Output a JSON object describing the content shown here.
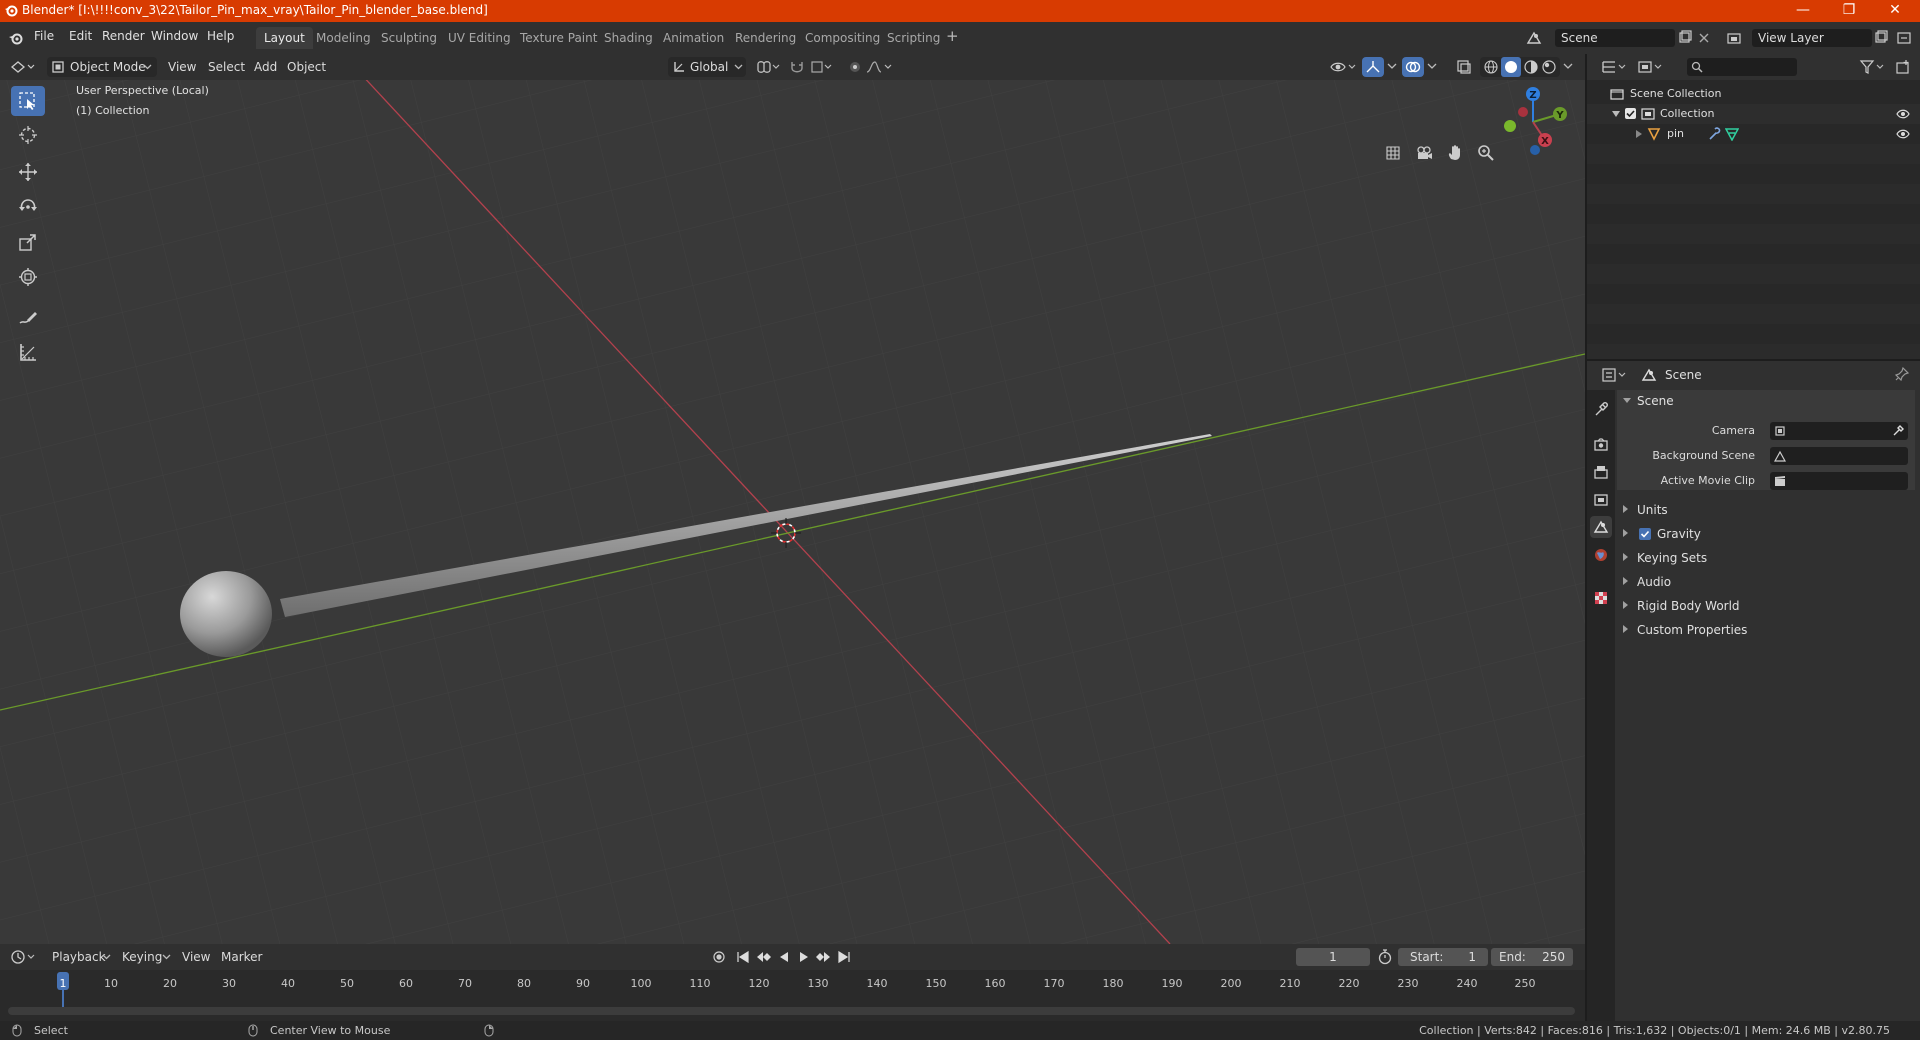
{
  "window": {
    "title": "Blender* [I:\\!!!!conv_3\\22\\Tailor_Pin_max_vray\\Tailor_Pin_blender_base.blend]",
    "minimize": "—",
    "maximize": "❐",
    "close": "✕"
  },
  "menus": [
    "File",
    "Edit",
    "Render",
    "Window",
    "Help"
  ],
  "workspaces": {
    "active": "Layout",
    "tabs": [
      "Layout",
      "Modeling",
      "Sculpting",
      "UV Editing",
      "Texture Paint",
      "Shading",
      "Animation",
      "Rendering",
      "Compositing",
      "Scripting"
    ],
    "add": "+"
  },
  "scene_field": "Scene",
  "view_layer_field": "View Layer",
  "viewport_header": {
    "mode": "Object Mode",
    "view": "View",
    "select": "Select",
    "add": "Add",
    "object": "Object",
    "transform_orientation": "Global"
  },
  "viewport": {
    "perspective": "User Perspective (Local)",
    "collection": "(1) Collection",
    "gizmo_axes": {
      "x": "X",
      "y": "Y",
      "z": "Z"
    }
  },
  "outliner": {
    "root": "Scene Collection",
    "collection": "Collection",
    "object": "pin"
  },
  "properties": {
    "header": "Scene",
    "panel_scene": "Scene",
    "camera_label": "Camera",
    "background_scene_label": "Background Scene",
    "active_movie_clip_label": "Active Movie Clip",
    "panels": [
      "Units",
      "Gravity",
      "Keying Sets",
      "Audio",
      "Rigid Body World",
      "Custom Properties"
    ],
    "gravity_checked": true
  },
  "timeline": {
    "playback": "Playback",
    "keying": "Keying",
    "view": "View",
    "marker": "Marker",
    "current_frame": "1",
    "start_label": "Start:",
    "start_value": "1",
    "end_label": "End:",
    "end_value": "250",
    "ruler": [
      "1",
      "10",
      "20",
      "30",
      "40",
      "50",
      "60",
      "70",
      "80",
      "90",
      "100",
      "110",
      "120",
      "130",
      "140",
      "150",
      "160",
      "170",
      "180",
      "190",
      "200",
      "210",
      "220",
      "230",
      "240",
      "250"
    ]
  },
  "statusbar": {
    "left_action": "Select",
    "middle_action": "Center View to Mouse",
    "stats": "Collection | Verts:842 | Faces:816 | Tris:1,632 | Objects:0/1 | Mem: 24.6 MB | v2.80.75"
  },
  "colors": {
    "accent": "#4772b3",
    "titlebar": "#d83b01",
    "x_axis": "#b3414d",
    "y_axis": "#6a9a2a",
    "z_axis": "#2f7fe0"
  }
}
